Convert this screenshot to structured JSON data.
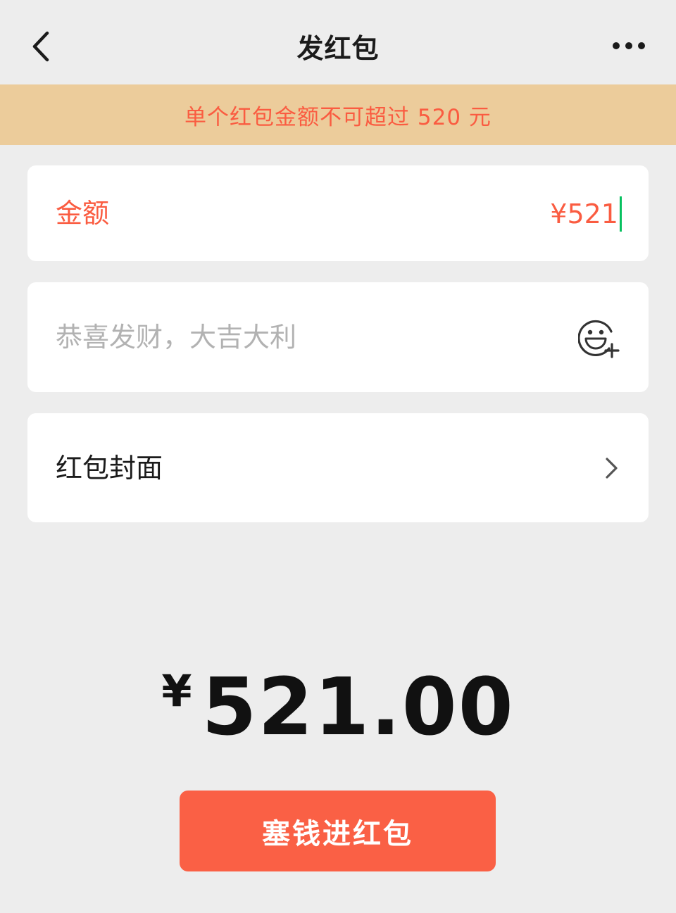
{
  "colors": {
    "accent": "#fa5c41",
    "notice_bg": "#eccc9b",
    "button_bg": "#fa6045",
    "caret": "#07c160"
  },
  "nav": {
    "title": "发红包",
    "back_icon": "chevron-left-icon",
    "more_icon": "more-dots-icon"
  },
  "notice": {
    "text": "单个红包金额不可超过 520 元"
  },
  "amount": {
    "label": "金额",
    "value": "¥521"
  },
  "blessing": {
    "placeholder": "恭喜发财，大吉大利",
    "emoji_icon": "emoji-add-icon"
  },
  "cover": {
    "label": "红包封面",
    "chevron_icon": "chevron-right-icon"
  },
  "total": {
    "currency": "¥",
    "amount": "521.00"
  },
  "submit": {
    "label": "塞钱进红包"
  }
}
